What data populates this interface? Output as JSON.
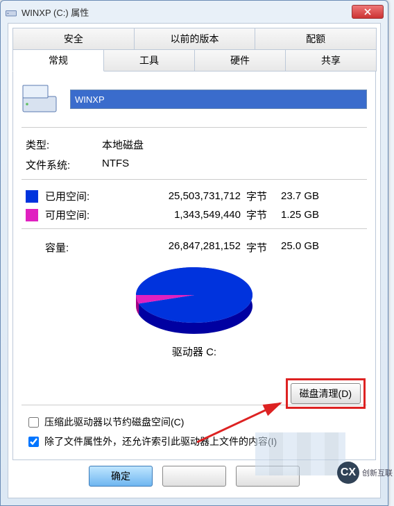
{
  "window": {
    "title": "WINXP (C:) 属性"
  },
  "tabs_top": [
    "安全",
    "以前的版本",
    "配额"
  ],
  "tabs_bottom": [
    "常规",
    "工具",
    "硬件",
    "共享"
  ],
  "active_tab_index": 0,
  "drive_name_value": "WINXP",
  "type_label": "类型:",
  "type_value": "本地磁盘",
  "fs_label": "文件系统:",
  "fs_value": "NTFS",
  "used": {
    "label": "已用空间:",
    "bytes": "25,503,731,712",
    "unit": "字节",
    "gb": "23.7 GB"
  },
  "free": {
    "label": "可用空间:",
    "bytes": "1,343,549,440",
    "unit": "字节",
    "gb": "1.25 GB"
  },
  "capacity": {
    "label": "容量:",
    "bytes": "26,847,281,152",
    "unit": "字节",
    "gb": "25.0 GB"
  },
  "drive_letter_label": "驱动器 C:",
  "cleanup_button": "磁盘清理(D)",
  "compress_label": "压缩此驱动器以节约磁盘空间(C)",
  "index_label": "除了文件属性外，还允许索引此驱动器上文件的内容(I)",
  "compress_checked": false,
  "index_checked": true,
  "footer": {
    "ok": "确定",
    "cancel": "",
    "apply": ""
  },
  "colors": {
    "used": "#0033dd",
    "free": "#e020c0"
  },
  "chart_data": {
    "type": "pie",
    "title": "驱动器 C:",
    "series": [
      {
        "name": "已用空间",
        "value": 25503731712,
        "color": "#0033dd"
      },
      {
        "name": "可用空间",
        "value": 1343549440,
        "color": "#e020c0"
      }
    ]
  },
  "watermark_text": "创新互联"
}
